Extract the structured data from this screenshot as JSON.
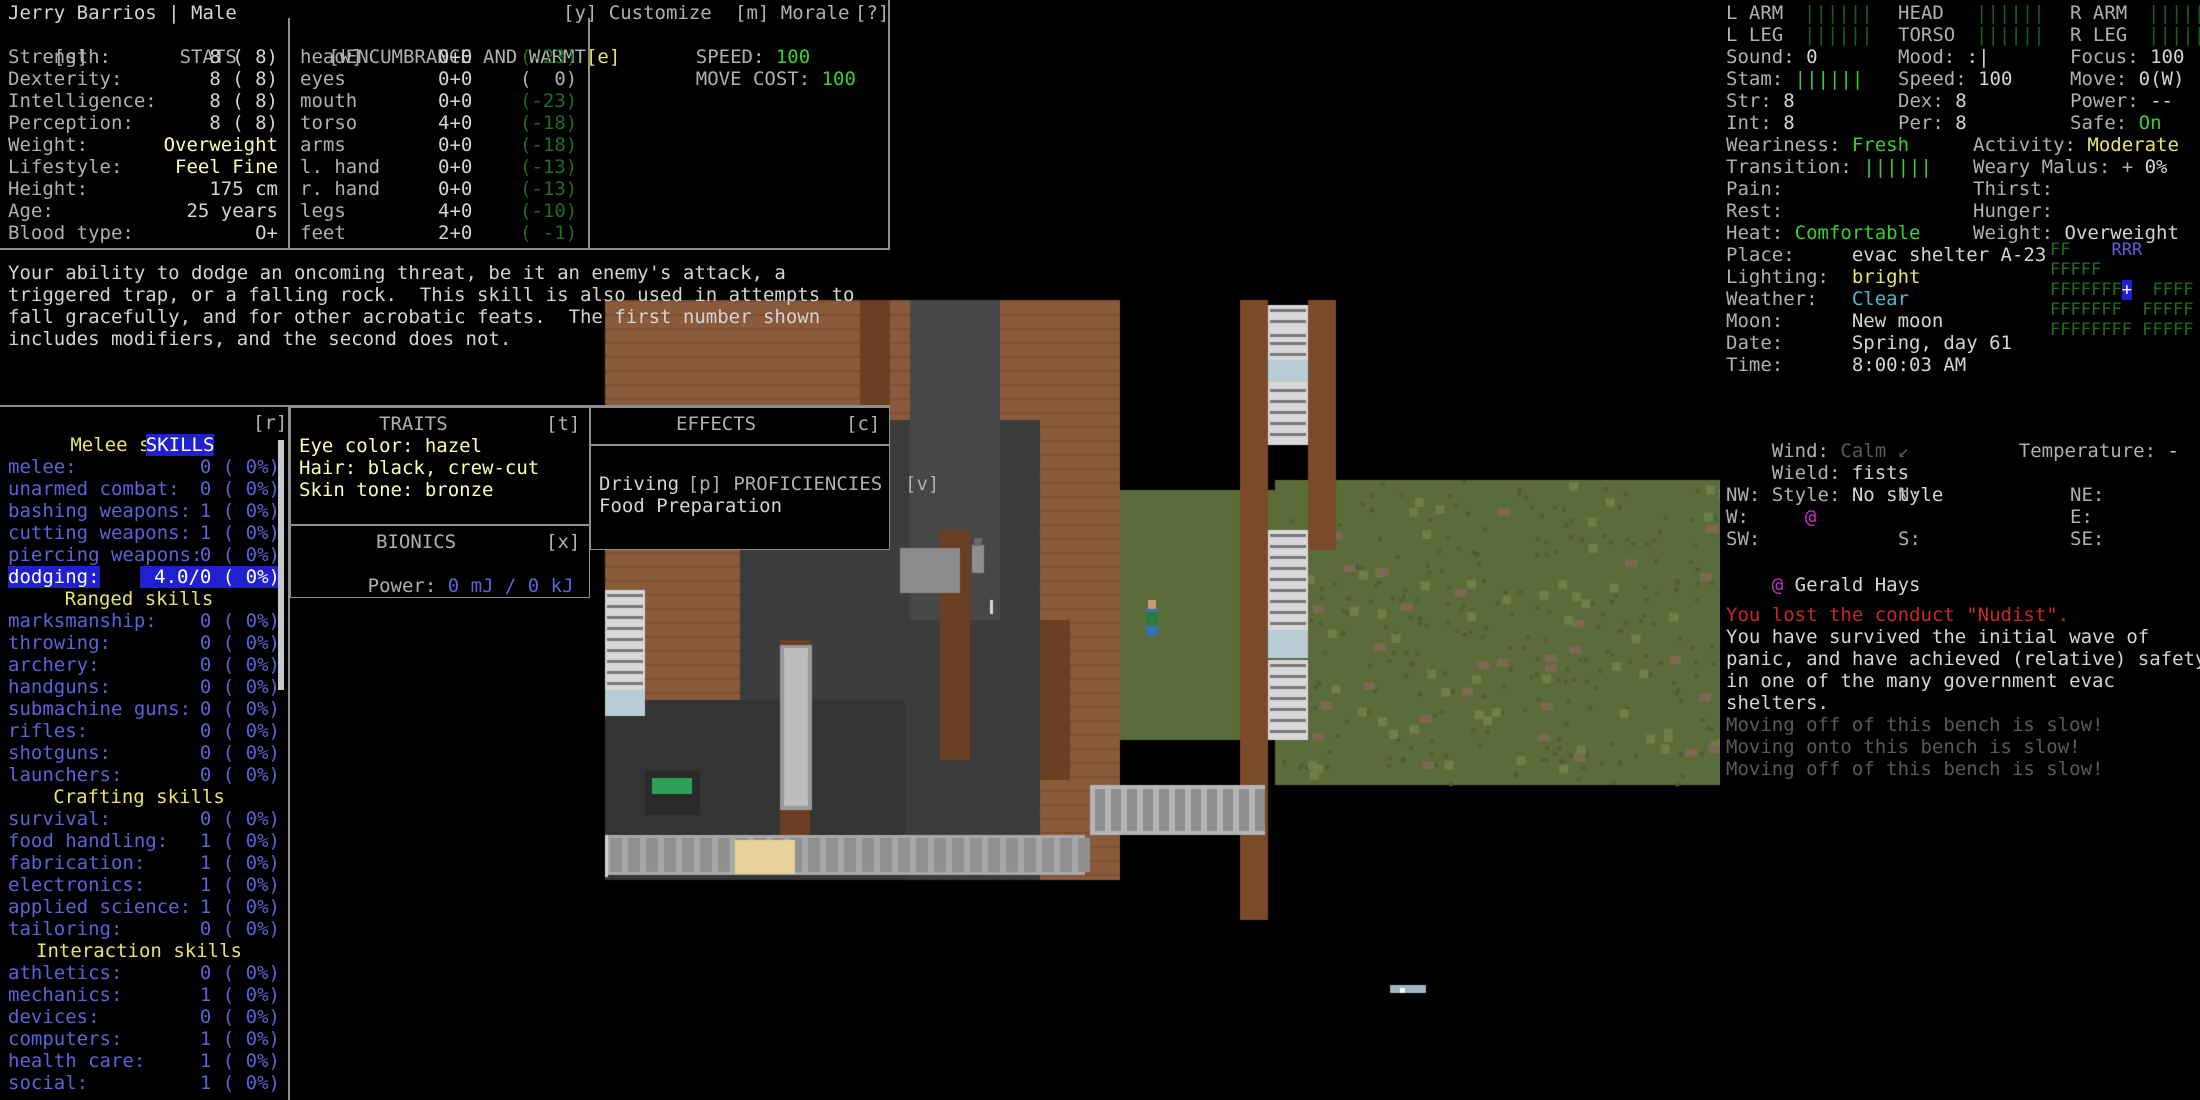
{
  "header": {
    "name_line": "Jerry Barrios | Male",
    "customize_key": "[y]",
    "customize_label": "Customize",
    "morale_key": "[m]",
    "morale_label": "Morale",
    "help_key": "[?]"
  },
  "stats_panel": {
    "key_left": "[s]",
    "title": "STATS",
    "key_right": "[w]",
    "rows": [
      {
        "label": "Strength:",
        "value": "8 ( 8)"
      },
      {
        "label": "Dexterity:",
        "value": "8 ( 8)"
      },
      {
        "label": "Intelligence:",
        "value": "8 ( 8)"
      },
      {
        "label": "Perception:",
        "value": "8 ( 8)"
      },
      {
        "label": "Weight:",
        "value": "Overweight"
      },
      {
        "label": "Lifestyle:",
        "value": "Feel Fine"
      },
      {
        "label": "Height:",
        "value": "175 cm"
      },
      {
        "label": "Age:",
        "value": "25 years"
      },
      {
        "label": "Blood type:",
        "value": "O+"
      }
    ]
  },
  "encumbrance_panel": {
    "title": "ENCUMBRANCE AND WARMT",
    "key_right": "[e]",
    "rows": [
      {
        "part": "head",
        "enc": "0+0",
        "warmth": "(-23)"
      },
      {
        "part": "eyes",
        "enc": "0+0",
        "warmth": "(  0)"
      },
      {
        "part": "mouth",
        "enc": "0+0",
        "warmth": "(-23)"
      },
      {
        "part": "torso",
        "enc": "4+0",
        "warmth": "(-18)"
      },
      {
        "part": "arms",
        "enc": "0+0",
        "warmth": "(-18)"
      },
      {
        "part": "l. hand",
        "enc": "0+0",
        "warmth": "(-13)"
      },
      {
        "part": "r. hand",
        "enc": "0+0",
        "warmth": "(-13)"
      },
      {
        "part": "legs",
        "enc": "4+0",
        "warmth": "(-10)"
      },
      {
        "part": "feet",
        "enc": "2+0",
        "warmth": "( -1)"
      }
    ]
  },
  "speed_panel": {
    "speed_label": "SPEED:",
    "speed_value": "100",
    "move_label": "MOVE COST:",
    "move_value": "100"
  },
  "description": {
    "lines": [
      "Your ability to dodge an oncoming threat, be it an enemy's attack, a",
      "triggered trap, or a falling rock.  This skill is also used in attempts to",
      "fall gracefully, and for other acrobatic feats.  The first number shown",
      "includes modifiers, and the second does not."
    ]
  },
  "skills_panel": {
    "title": "SKILLS",
    "key_right": "[r]",
    "groups": [
      {
        "header": "Melee skills",
        "skills": [
          {
            "name": "melee:",
            "level": "0",
            "pct": "( 0%)",
            "selected": false
          },
          {
            "name": "unarmed combat:",
            "level": "0",
            "pct": "( 0%)",
            "selected": false
          },
          {
            "name": "bashing weapons:",
            "level": "1",
            "pct": "( 0%)",
            "selected": false
          },
          {
            "name": "cutting weapons:",
            "level": "1",
            "pct": "( 0%)",
            "selected": false
          },
          {
            "name": "piercing weapons:",
            "level": "0",
            "pct": "( 0%)",
            "selected": false
          },
          {
            "name": "dodging:",
            "level": "4.0/0",
            "pct": "( 0%)",
            "selected": true
          }
        ]
      },
      {
        "header": "Ranged skills",
        "skills": [
          {
            "name": "marksmanship:",
            "level": "0",
            "pct": "( 0%)",
            "selected": false
          },
          {
            "name": "throwing:",
            "level": "0",
            "pct": "( 0%)",
            "selected": false
          },
          {
            "name": "archery:",
            "level": "0",
            "pct": "( 0%)",
            "selected": false
          },
          {
            "name": "handguns:",
            "level": "0",
            "pct": "( 0%)",
            "selected": false
          },
          {
            "name": "submachine guns:",
            "level": "0",
            "pct": "( 0%)",
            "selected": false
          },
          {
            "name": "rifles:",
            "level": "0",
            "pct": "( 0%)",
            "selected": false
          },
          {
            "name": "shotguns:",
            "level": "0",
            "pct": "( 0%)",
            "selected": false
          },
          {
            "name": "launchers:",
            "level": "0",
            "pct": "( 0%)",
            "selected": false
          }
        ]
      },
      {
        "header": "Crafting skills",
        "skills": [
          {
            "name": "survival:",
            "level": "0",
            "pct": "( 0%)",
            "selected": false
          },
          {
            "name": "food handling:",
            "level": "1",
            "pct": "( 0%)",
            "selected": false
          },
          {
            "name": "fabrication:",
            "level": "1",
            "pct": "( 0%)",
            "selected": false
          },
          {
            "name": "electronics:",
            "level": "1",
            "pct": "( 0%)",
            "selected": false
          },
          {
            "name": "applied science:",
            "level": "1",
            "pct": "( 0%)",
            "selected": false
          },
          {
            "name": "tailoring:",
            "level": "0",
            "pct": "( 0%)",
            "selected": false
          }
        ]
      },
      {
        "header": "Interaction skills",
        "skills": [
          {
            "name": "athletics:",
            "level": "0",
            "pct": "( 0%)",
            "selected": false
          },
          {
            "name": "mechanics:",
            "level": "1",
            "pct": "( 0%)",
            "selected": false
          },
          {
            "name": "devices:",
            "level": "0",
            "pct": "( 0%)",
            "selected": false
          },
          {
            "name": "computers:",
            "level": "1",
            "pct": "( 0%)",
            "selected": false
          },
          {
            "name": "health care:",
            "level": "1",
            "pct": "( 0%)",
            "selected": false
          },
          {
            "name": "social:",
            "level": "1",
            "pct": "( 0%)",
            "selected": false
          }
        ]
      }
    ]
  },
  "traits_panel": {
    "title": "TRAITS",
    "key_right": "[t]",
    "rows": [
      "Eye color: hazel",
      "Hair: black, crew-cut",
      "Skin tone: bronze"
    ]
  },
  "bionics_panel": {
    "title": "BIONICS",
    "key_right": "[x]",
    "power_label": "Power:",
    "power_value": "0 mJ / 0 kJ"
  },
  "effects_panel": {
    "title": "EFFECTS",
    "key_right": "[c]",
    "rows": []
  },
  "proficiencies_panel": {
    "key_left": "[p]",
    "title": "PROFICIENCIES",
    "key_right": "[v]",
    "rows": [
      "Driving",
      "Food Preparation"
    ]
  },
  "sidebar": {
    "body_parts": [
      {
        "label": "L ARM",
        "bar": "||||||"
      },
      {
        "label": "HEAD",
        "bar": "||||||"
      },
      {
        "label": "R ARM",
        "bar": "||||||"
      },
      {
        "label": "L LEG",
        "bar": "||||||"
      },
      {
        "label": "TORSO",
        "bar": "||||||"
      },
      {
        "label": "R LEG",
        "bar": "||||||"
      }
    ],
    "stats_grid": [
      [
        {
          "label": "Sound:",
          "value": "0",
          "vcolor": "white"
        },
        {
          "label": "Mood:",
          "value": ":|",
          "vcolor": "white"
        },
        {
          "label": "Focus:",
          "value": "100",
          "vcolor": "white"
        }
      ],
      [
        {
          "label": "Stam:",
          "value": "||||||",
          "vcolor": "green"
        },
        {
          "label": "Speed:",
          "value": "100",
          "vcolor": "white"
        },
        {
          "label": "Move:",
          "value": "0(W)",
          "vcolor": "white"
        }
      ],
      [
        {
          "label": "Str:",
          "value": "8",
          "vcolor": "white"
        },
        {
          "label": "Dex:",
          "value": "8",
          "vcolor": "white"
        },
        {
          "label": "Power:",
          "value": "--",
          "vcolor": "white"
        }
      ],
      [
        {
          "label": "Int:",
          "value": "8",
          "vcolor": "white"
        },
        {
          "label": "Per:",
          "value": "8",
          "vcolor": "white"
        },
        {
          "label": "Safe:",
          "value": "On",
          "vcolor": "green"
        }
      ]
    ],
    "two_col": [
      {
        "l_label": "Weariness:",
        "l_value": "Fresh",
        "l_color": "green",
        "r_label": "Activity:",
        "r_value": "Moderate",
        "r_color": "yellow"
      },
      {
        "l_label": "Transition:",
        "l_value": "||||||",
        "l_color": "green",
        "r_label": "Weary Malus: +",
        "r_value": "0%",
        "r_color": "white"
      },
      {
        "l_label": "Pain:",
        "l_value": "",
        "l_color": "white",
        "r_label": "Thirst:",
        "r_value": "",
        "r_color": "white"
      },
      {
        "l_label": "Rest:",
        "l_value": "",
        "l_color": "white",
        "r_label": "Hunger:",
        "r_value": "",
        "r_color": "white"
      },
      {
        "l_label": "Heat:",
        "l_value": "Comfortable",
        "l_color": "green",
        "r_label": "Weight:",
        "r_value": "Overweight",
        "r_color": "white"
      }
    ],
    "env": [
      {
        "label": "Place:",
        "value": "evac shelter A-23",
        "color": "white"
      },
      {
        "label": "Lighting:",
        "value": "bright",
        "color": "yellow"
      },
      {
        "label": "Weather:",
        "value": "Clear",
        "color": "cyan"
      },
      {
        "label": "Moon:",
        "value": "New moon",
        "color": "white"
      },
      {
        "label": "Date:",
        "value": "Spring, day 61",
        "color": "white"
      },
      {
        "label": "Time:",
        "value": "8:00:03 AM",
        "color": "white"
      }
    ],
    "wind_label": "Wind:",
    "wind_value": "Calm",
    "wind_arrow": "↙",
    "temp_label": "Temperature:",
    "temp_value": "-",
    "wield_label": "Wield:",
    "wield_value": "fists",
    "style_label": "Style:",
    "style_value": "No style",
    "compass": [
      {
        "label": "NW:",
        "value": ""
      },
      {
        "label": "N:",
        "value": ""
      },
      {
        "label": "NE:",
        "value": ""
      },
      {
        "label": "W:",
        "value": "@",
        "vcolor": "magenta"
      },
      {
        "label": "E:",
        "value": ""
      },
      {
        "label": "SW:",
        "value": ""
      },
      {
        "label": "S:",
        "value": ""
      },
      {
        "label": "SE:",
        "value": ""
      }
    ],
    "nearby_creature": {
      "glyph": "@",
      "name": "Gerald Hays"
    },
    "minimap_rows": [
      "FF    RRR",
      "FFFFF",
      "FFFFFFF+  FFFF",
      "FFFFFFF  FFFFF",
      "FFFFFFFF FFFFF"
    ],
    "messages": [
      {
        "text": "You lost the conduct \"Nudist\".",
        "color": "red"
      },
      {
        "text": "You have survived the initial wave of",
        "color": "white"
      },
      {
        "text": "panic, and have achieved (relative) safety",
        "color": "white"
      },
      {
        "text": "in one of the many government evac",
        "color": "white"
      },
      {
        "text": "shelters.",
        "color": "white"
      },
      {
        "text": "Moving off of this bench is slow!",
        "color": "dkgray"
      },
      {
        "text": "Moving onto this bench is slow!",
        "color": "dkgray"
      },
      {
        "text": "Moving off of this bench is slow!",
        "color": "dkgray"
      }
    ]
  },
  "colors": {
    "accent_blue": "#2020d0",
    "skill_blue": "#5b63d8",
    "header_yellow": "#e8e46a",
    "green": "#38d030",
    "red": "#c62828",
    "magenta": "#c832c8"
  }
}
